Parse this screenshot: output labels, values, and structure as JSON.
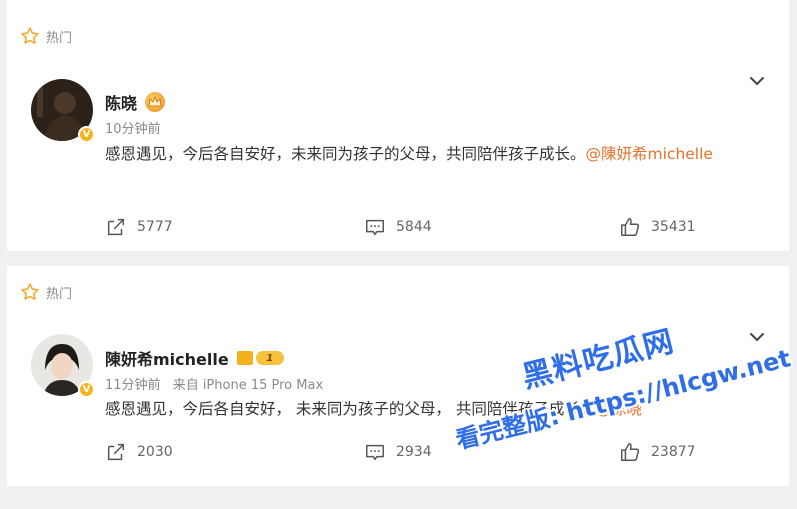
{
  "posts": [
    {
      "hot_label": "热门",
      "author": "陈晓",
      "time": "10分钟前",
      "source": "",
      "text": "感恩遇见，今后各自安好，未来同为孩子的父母，共同陪伴孩子成长。",
      "mention": "@陳妍希michelle",
      "stats": {
        "repost": "5777",
        "comment": "5844",
        "like": "35431"
      }
    },
    {
      "hot_label": "热门",
      "author": "陳妍希michelle",
      "time": "11分钟前",
      "source": "来自 iPhone 15 Pro Max",
      "text": "感恩遇见，今后各自安好， 未来同为孩子的父母， 共同陪伴孩子成长。",
      "mention": "@陈晓",
      "level_badge": "1",
      "stats": {
        "repost": "2030",
        "comment": "2934",
        "like": "23877"
      }
    }
  ],
  "watermark": {
    "line1": "黑料吃瓜网",
    "line2": "看完整版: https://hlcgw.net"
  },
  "colors": {
    "mention": "#e8702a",
    "background": "#f0f0f0",
    "badge": "#f7b319",
    "watermark": "#2f6ee8"
  }
}
